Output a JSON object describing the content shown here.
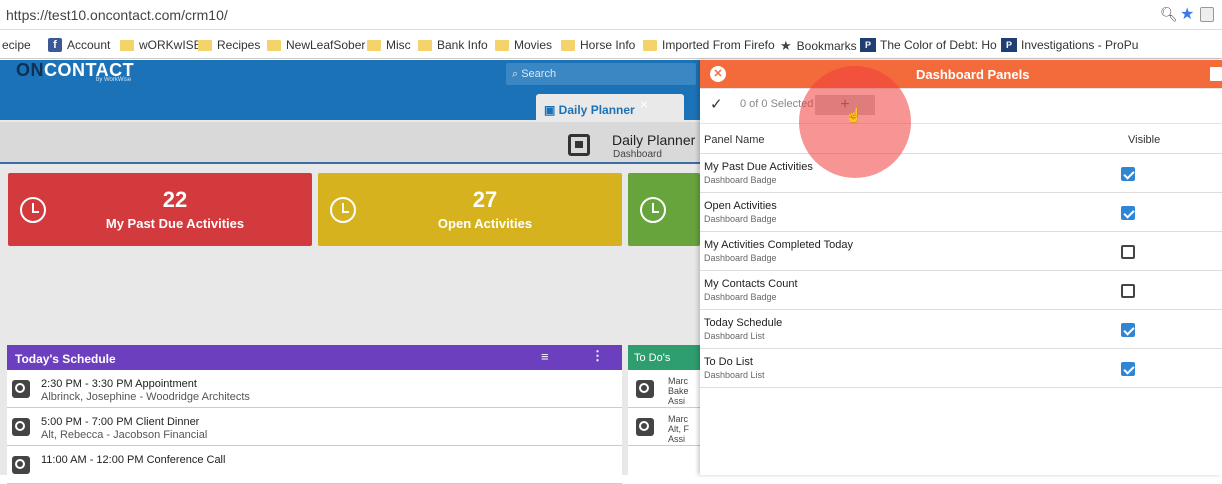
{
  "browser": {
    "url": "https://test10.oncontact.com/crm10/",
    "bookmarks": [
      {
        "label": "ecipe",
        "icon": "folder-icon"
      },
      {
        "label": "Account",
        "icon": "facebook-icon"
      },
      {
        "label": "wORKwISE",
        "icon": "folder-icon"
      },
      {
        "label": "Recipes",
        "icon": "folder-icon"
      },
      {
        "label": "NewLeafSober",
        "icon": "folder-icon"
      },
      {
        "label": "Misc",
        "icon": "folder-icon"
      },
      {
        "label": "Bank Info",
        "icon": "folder-icon"
      },
      {
        "label": "Movies",
        "icon": "folder-icon"
      },
      {
        "label": "Horse Info",
        "icon": "folder-icon"
      },
      {
        "label": "Imported From Firefo",
        "icon": "folder-icon"
      },
      {
        "label": "Bookmarks",
        "icon": "star-icon"
      },
      {
        "label": "The Color of Debt: Ho",
        "icon": "propublica-icon"
      },
      {
        "label": "Investigations - ProPu",
        "icon": "propublica-icon"
      }
    ]
  },
  "app": {
    "logo_on": "ON",
    "logo_contact": "CONTACT",
    "logo_sub": "by WorkWise",
    "search_placeholder": "Search",
    "tab_label": "Daily Planner",
    "page_title": "Daily Planner",
    "page_subtitle": "Dashboard"
  },
  "badges": [
    {
      "value": "22",
      "label": "My Past Due Activities",
      "color": "#d23a3d"
    },
    {
      "value": "27",
      "label": "Open Activities",
      "color": "#d6b21f"
    },
    {
      "value": "",
      "label": "",
      "color": "#67a43b"
    }
  ],
  "schedule": {
    "title": "Today's Schedule",
    "items": [
      {
        "time": "2:30 PM - 3:30 PM Appointment",
        "who": "Albrinck, Josephine  - Woodridge Architects"
      },
      {
        "time": "5:00 PM - 7:00 PM Client Dinner",
        "who": "Alt, Rebecca  - Jacobson Financial"
      },
      {
        "time": "11:00 AM - 12:00 PM Conference Call",
        "who": ""
      }
    ]
  },
  "todo": {
    "title": "To Do's",
    "items": [
      {
        "l1": "Marc",
        "l2": "Bake",
        "l3": "Assi"
      },
      {
        "l1": "Marc",
        "l2": "Alt, F",
        "l3": "Assi"
      }
    ]
  },
  "panel": {
    "title": "Dashboard Panels",
    "selected_text": "0 of 0 Selected",
    "add_label": "+",
    "col_name": "Panel Name",
    "col_visible": "Visible",
    "rows": [
      {
        "name": "My Past Due Activities",
        "type": "Dashboard Badge",
        "visible": true
      },
      {
        "name": "Open Activities",
        "type": "Dashboard Badge",
        "visible": true
      },
      {
        "name": "My Activities Completed Today",
        "type": "Dashboard Badge",
        "visible": false
      },
      {
        "name": "My Contacts Count",
        "type": "Dashboard Badge",
        "visible": false
      },
      {
        "name": "Today Schedule",
        "type": "Dashboard List",
        "visible": true
      },
      {
        "name": "To Do List",
        "type": "Dashboard List",
        "visible": true
      }
    ]
  },
  "colors": {
    "header": "#1c72b6",
    "panel_header": "#f36b3b",
    "schedule_header": "#6c3fbf",
    "todo_header": "#2e9e6e"
  }
}
